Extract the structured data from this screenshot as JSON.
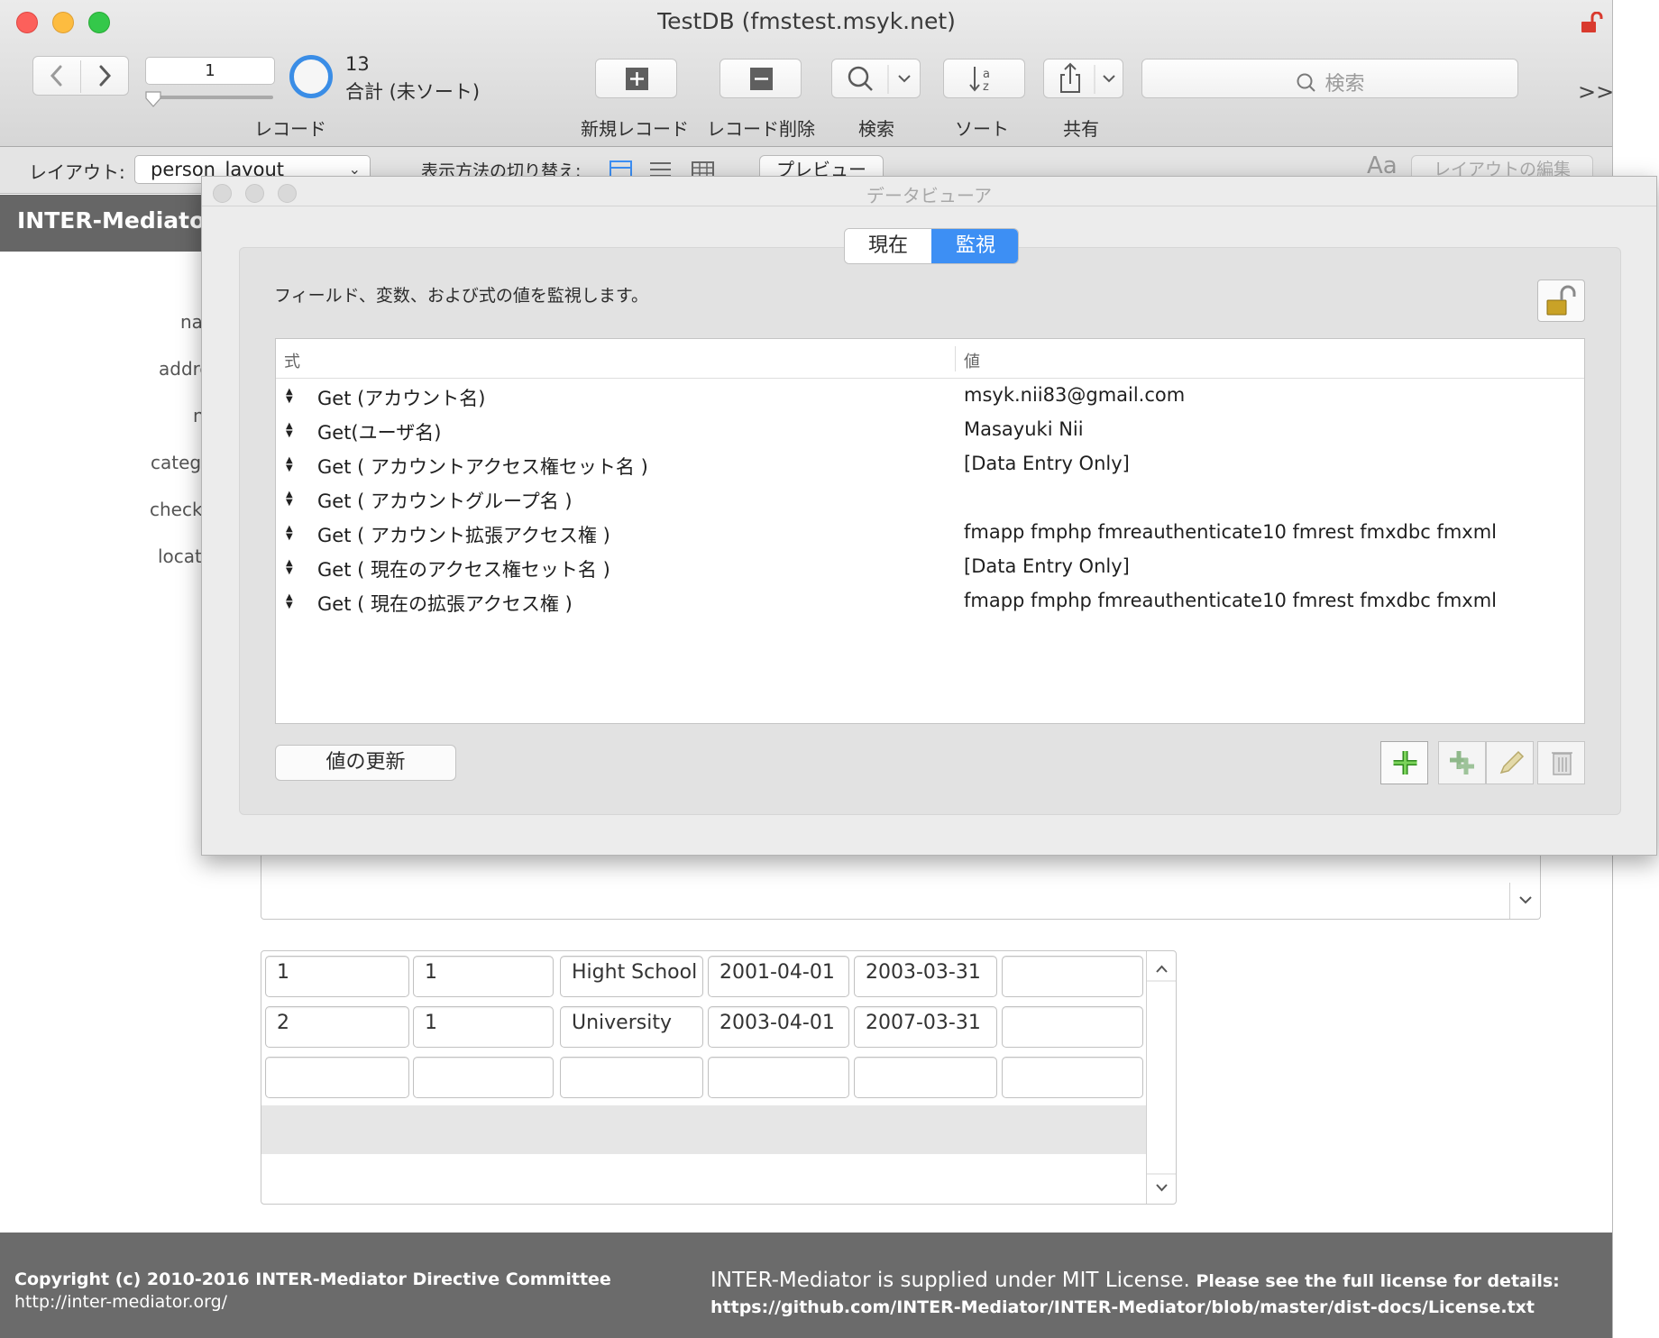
{
  "window": {
    "title": "TestDB (fmstest.msyk.net)"
  },
  "toolbar": {
    "record_number": "1",
    "total_count": "13",
    "total_status": "合計 (未ソート)",
    "record_label": "レコード",
    "new_record_label": "新規レコード",
    "delete_record_label": "レコード削除",
    "find_label": "検索",
    "sort_label": "ソート",
    "share_label": "共有",
    "search_placeholder": "検索"
  },
  "layout_bar": {
    "layout_label": "レイアウト:",
    "layout_name": "person_layout",
    "view_as_label": "表示方法の切り替え:",
    "preview_label": "プレビュー",
    "edit_layout_label": "レイアウトの編集",
    "font_icon_text": "Aa"
  },
  "app": {
    "title": "INTER-Mediator S",
    "field_labels": [
      "na",
      "addre",
      "n",
      "categ",
      "check",
      "locat"
    ]
  },
  "sub_table": {
    "rows": [
      [
        "1",
        "1",
        "Hight School",
        "2001-04-01",
        "2003-03-31",
        ""
      ],
      [
        "2",
        "1",
        "University",
        "2003-04-01",
        "2007-03-31",
        ""
      ],
      [
        "",
        "",
        "",
        "",
        "",
        ""
      ]
    ]
  },
  "footer": {
    "copyright": "Copyright (c) 2010-2016 INTER-Mediator Directive Committee",
    "site": "http://inter-mediator.org/",
    "license_lead": "INTER-Mediator is supplied under MIT License.",
    "license_tail": " Please see the full license for details:",
    "license_url": "https://github.com/INTER-Mediator/INTER-Mediator/blob/master/dist-docs/License.txt"
  },
  "data_viewer": {
    "title": "データビューア",
    "tabs": {
      "current": "現在",
      "watch": "監視"
    },
    "description": "フィールド、変数、および式の値を監視します。",
    "headers": {
      "expression": "式",
      "value": "値"
    },
    "rows": [
      {
        "expr": "Get (アカウント名)",
        "value": "msyk.nii83@gmail.com"
      },
      {
        "expr": "Get(ユーザ名)",
        "value": "Masayuki Nii"
      },
      {
        "expr": "Get ( アカウントアクセス権セット名 )",
        "value": "[Data Entry Only]"
      },
      {
        "expr": "Get ( アカウントグループ名 )",
        "value": ""
      },
      {
        "expr": "Get ( アカウント拡張アクセス権 )",
        "value": "fmapp fmphp fmreauthenticate10 fmrest fmxdbc fmxml"
      },
      {
        "expr": "Get ( 現在のアクセス権セット名 )",
        "value": "[Data Entry Only]"
      },
      {
        "expr": "Get ( 現在の拡張アクセス権 )",
        "value": "fmapp fmphp fmreauthenticate10 fmrest fmxdbc fmxml"
      }
    ],
    "refresh_label": "値の更新"
  },
  "colors": {
    "accent": "#3d8ff4",
    "header_bg": "#666666",
    "footer_bg": "#6b6b6b"
  }
}
